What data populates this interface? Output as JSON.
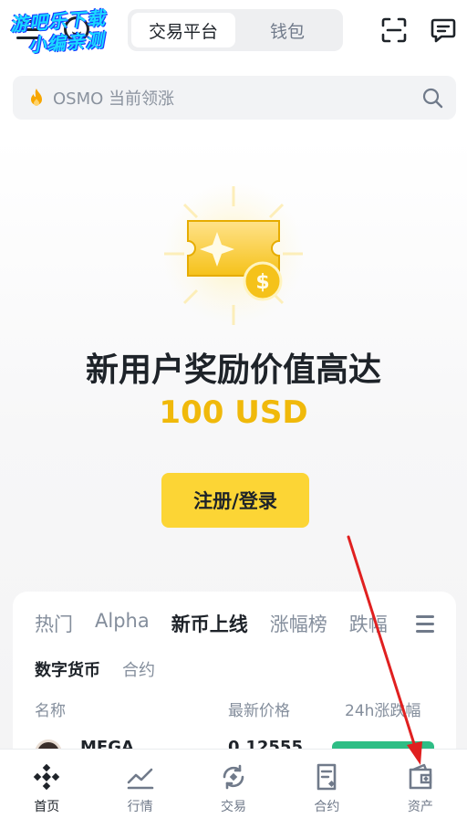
{
  "header": {
    "watermark_line1": "游吧乐下载",
    "watermark_line2": "小编亲测",
    "tabs": [
      {
        "label": "交易平台",
        "active": true
      },
      {
        "label": "钱包",
        "active": false
      }
    ]
  },
  "search": {
    "icon": "flame-icon",
    "placeholder": "OSMO 当前领涨"
  },
  "promo": {
    "title": "新用户奖励价值高达",
    "amount": "100 USD",
    "button_label": "注册/登录"
  },
  "market": {
    "category_tabs": [
      {
        "label": "热门",
        "active": false
      },
      {
        "label": "Alpha",
        "active": false
      },
      {
        "label": "新币上线",
        "active": true
      },
      {
        "label": "涨幅榜",
        "active": false
      },
      {
        "label": "跌幅",
        "active": false
      }
    ],
    "sub_tabs": [
      {
        "label": "数字货币",
        "active": true
      },
      {
        "label": "合约",
        "active": false
      }
    ],
    "columns": {
      "name": "名称",
      "price": "最新价格",
      "change": "24h涨跌幅"
    },
    "rows": [
      {
        "name": "MEGA",
        "price": "0.12555",
        "change": ""
      }
    ]
  },
  "bottom_nav": [
    {
      "label": "首页",
      "icon": "home-icon",
      "active": true
    },
    {
      "label": "行情",
      "icon": "markets-icon",
      "active": false
    },
    {
      "label": "交易",
      "icon": "trade-icon",
      "active": false
    },
    {
      "label": "合约",
      "icon": "futures-icon",
      "active": false
    },
    {
      "label": "资产",
      "icon": "wallet-icon",
      "active": false
    }
  ],
  "colors": {
    "brand_yellow": "#fcd535",
    "amount_gold": "#f0b90b",
    "positive_green": "#2ebd85",
    "annotation_red": "#e02020"
  }
}
